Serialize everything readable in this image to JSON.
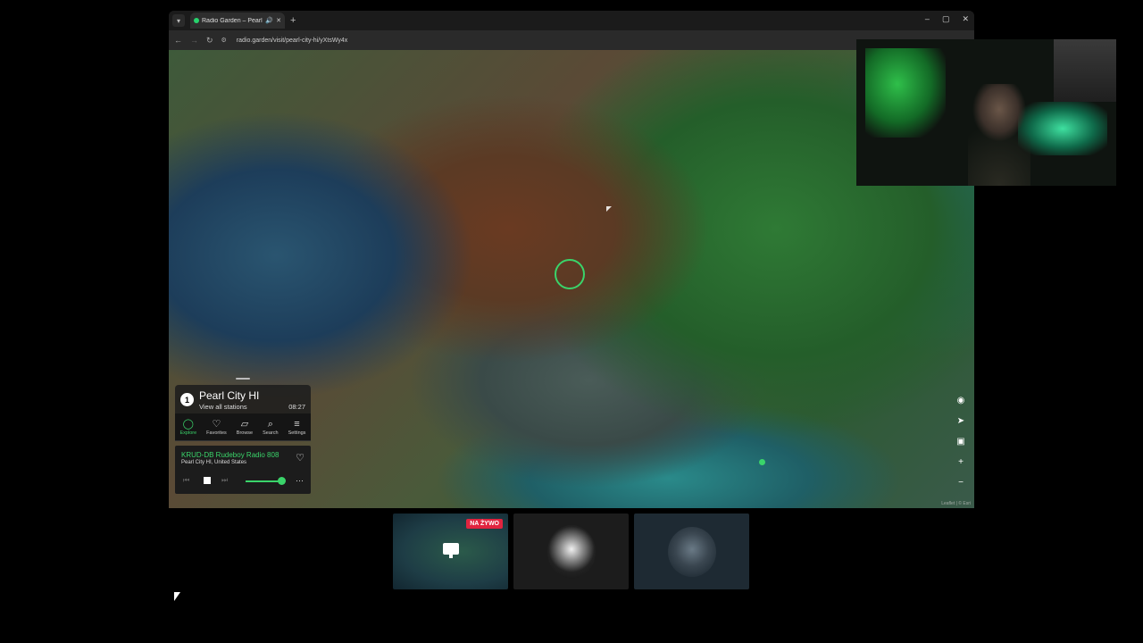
{
  "browser": {
    "tab_title": "Radio Garden – Pearl City H",
    "tab_audio_icon": "speaker-icon",
    "new_tab": "+",
    "url": "radio.garden/visit/pearl-city-hi/yXtsWy4x",
    "window_controls": [
      "–",
      "▢",
      "✕"
    ]
  },
  "place": {
    "name": "Pearl City HI",
    "link": "View all stations",
    "time": "08:27",
    "badge": "1"
  },
  "nav": {
    "items": [
      {
        "label": "Explore",
        "icon": "explore-icon"
      },
      {
        "label": "Favorites",
        "icon": "heart-icon"
      },
      {
        "label": "Browse",
        "icon": "map-icon"
      },
      {
        "label": "Search",
        "icon": "search-icon"
      },
      {
        "label": "Settings",
        "icon": "menu-icon"
      }
    ],
    "active": "Explore"
  },
  "player": {
    "station": "KRUD-DB Rudeboy Radio 808",
    "location": "Pearl City HI, United States",
    "volume": 0.95
  },
  "map": {
    "attribution": "Leaflet | © Esri"
  },
  "thumbnails": {
    "live_badge": "NA ŻYWO"
  },
  "colors": {
    "accent": "#3ad46a",
    "live": "#e0243f"
  }
}
